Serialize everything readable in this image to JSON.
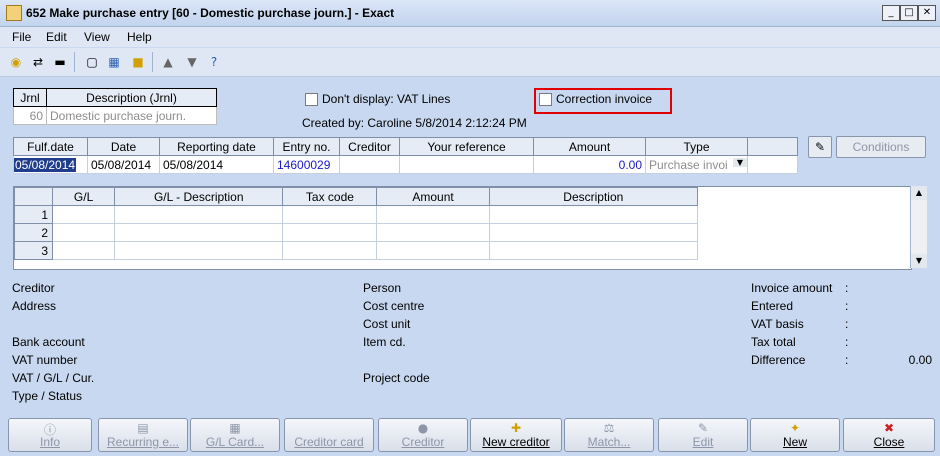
{
  "window": {
    "title": "652 Make purchase entry [60 - Domestic purchase journ.] - Exact",
    "min": "_",
    "max": "□",
    "close": "✕"
  },
  "menu": [
    "File",
    "Edit",
    "View",
    "Help"
  ],
  "journal": {
    "headers": [
      "Jrnl",
      "Description (Jrnl)"
    ],
    "code": "60",
    "description": "Domestic purchase journ."
  },
  "options": {
    "dont_display": "Don't display: VAT Lines",
    "correction_invoice": "Correction invoice"
  },
  "created_by": "Created by: Caroline  5/8/2014 2:12:24 PM",
  "entry": {
    "headers": [
      "Fulf.date",
      "Date",
      "Reporting date",
      "Entry no.",
      "Creditor",
      "Your reference",
      "Amount",
      "Type"
    ],
    "values": [
      "05/08/2014",
      "05/08/2014",
      "05/08/2014",
      "14600029",
      "",
      "",
      "0.00",
      "Purchase invoi"
    ]
  },
  "conditions_button": "Conditions",
  "lines": {
    "headers": [
      "G/L",
      "G/L - Description",
      "Tax code",
      "Amount",
      "Description"
    ],
    "rows": [
      "1",
      "2",
      "3"
    ]
  },
  "info": {
    "left": [
      "Creditor",
      "Address",
      "",
      "Bank account",
      "VAT number",
      "VAT / G/L / Cur.",
      "Type / Status"
    ],
    "middle": [
      "Person",
      "Cost centre",
      "Cost unit",
      "Item cd.",
      "",
      "Project code"
    ],
    "right_labels": [
      "Invoice amount",
      "Entered",
      "VAT basis",
      "Tax total",
      "Difference"
    ],
    "colon": ":",
    "difference_value": "0.00"
  },
  "buttons": [
    {
      "label": "Info",
      "icon": "info-icon",
      "glyph": "ⓘ",
      "enabled": false
    },
    {
      "label": "Recurring e...",
      "icon": "recurring-icon",
      "glyph": "▤",
      "enabled": false
    },
    {
      "label": "G/L Card...",
      "icon": "gl-card-icon",
      "glyph": "▦",
      "enabled": false
    },
    {
      "label": "Creditor card",
      "icon": "creditor-card-icon",
      "glyph": "",
      "enabled": false
    },
    {
      "label": "Creditor",
      "icon": "creditor-icon",
      "glyph": "●",
      "enabled": false
    },
    {
      "label": "New creditor",
      "icon": "new-creditor-icon",
      "glyph": "✚",
      "enabled": true
    },
    {
      "label": "Match...",
      "icon": "match-icon",
      "glyph": "⚖",
      "enabled": false
    },
    {
      "label": "Edit",
      "icon": "edit-icon",
      "glyph": "✎",
      "enabled": false
    },
    {
      "label": "New",
      "icon": "new-icon",
      "glyph": "✦",
      "enabled": true
    },
    {
      "label": "Close",
      "icon": "close-icon",
      "glyph": "✖",
      "enabled": true
    }
  ],
  "colors": {
    "background": "#c8d8f0",
    "highlight": "#e00000",
    "link": "#1a1ac8"
  }
}
